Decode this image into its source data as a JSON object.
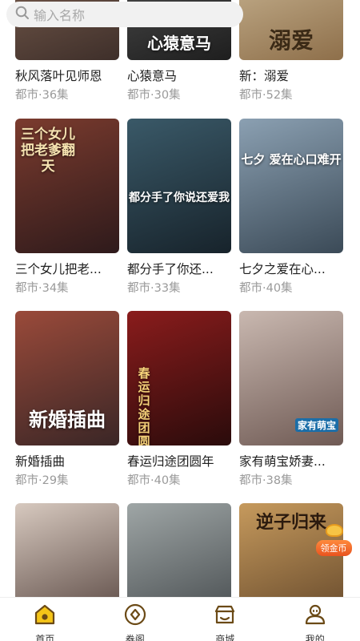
{
  "search": {
    "placeholder": "输入名称"
  },
  "colors": {
    "accent": "#f5c518",
    "accent_dark": "#6b4a16"
  },
  "dramas": [
    {
      "title": "秋风落叶见师恩",
      "category": "都市",
      "episodes": "36集",
      "poster_text": "",
      "bg": "linear-gradient(160deg,#8a6a58,#3e2f2a)"
    },
    {
      "title": "心猿意马",
      "category": "都市",
      "episodes": "30集",
      "poster_text": "心猿意马",
      "bg": "linear-gradient(160deg,#5b5b5b,#1e1e1e)"
    },
    {
      "title": "新：溺爱",
      "category": "都市",
      "episodes": "52集",
      "poster_text": "溺爱",
      "bg": "linear-gradient(160deg,#d8c7a6,#8e6f4a)"
    },
    {
      "title": "三个女儿把老...",
      "category": "都市",
      "episodes": "34集",
      "poster_text": "三个女儿把老爹翻天",
      "bg": "linear-gradient(160deg,#7b3b2e,#2e1a1b)"
    },
    {
      "title": "都分手了你还...",
      "category": "都市",
      "episodes": "33集",
      "poster_text": "都分手了你说还爱我",
      "bg": "linear-gradient(160deg,#3a5968,#17232b)"
    },
    {
      "title": "七夕之爱在心...",
      "category": "都市",
      "episodes": "40集",
      "poster_text": "七夕 爱在心口难开",
      "bg": "linear-gradient(160deg,#8ba0b2,#3b4a57)"
    },
    {
      "title": "新婚插曲",
      "category": "都市",
      "episodes": "29集",
      "poster_text": "新婚插曲",
      "bg": "linear-gradient(160deg,#9a4a3a,#3a2626)"
    },
    {
      "title": "春运归途团圆年",
      "category": "都市",
      "episodes": "40集",
      "poster_text": "春运归途团圆年",
      "bg": "linear-gradient(160deg,#8a1c1c,#2a0b0b)"
    },
    {
      "title": "家有萌宝娇妻...",
      "category": "都市",
      "episodes": "38集",
      "poster_text": "家有萌宝",
      "bg": "linear-gradient(160deg,#c9b8b0,#6f5a54)"
    },
    {
      "title": "",
      "category": "",
      "episodes": "",
      "poster_text": "",
      "bg": "linear-gradient(160deg,#d7c9bf,#4d3b36)"
    },
    {
      "title": "",
      "category": "",
      "episodes": "",
      "poster_text": "",
      "bg": "linear-gradient(160deg,#9fa6a6,#3e4346)"
    },
    {
      "title": "",
      "category": "",
      "episodes": "",
      "poster_text": "逆子归来",
      "bg": "linear-gradient(160deg,#c69a5d,#5b4026)"
    }
  ],
  "coin_badge": {
    "label": "领金币"
  },
  "tabs": [
    {
      "label": "首页",
      "icon": "home-icon",
      "active": true
    },
    {
      "label": "券阁",
      "icon": "coupon-icon",
      "active": false
    },
    {
      "label": "商城",
      "icon": "store-icon",
      "active": false
    },
    {
      "label": "我的",
      "icon": "profile-icon",
      "active": false
    }
  ]
}
